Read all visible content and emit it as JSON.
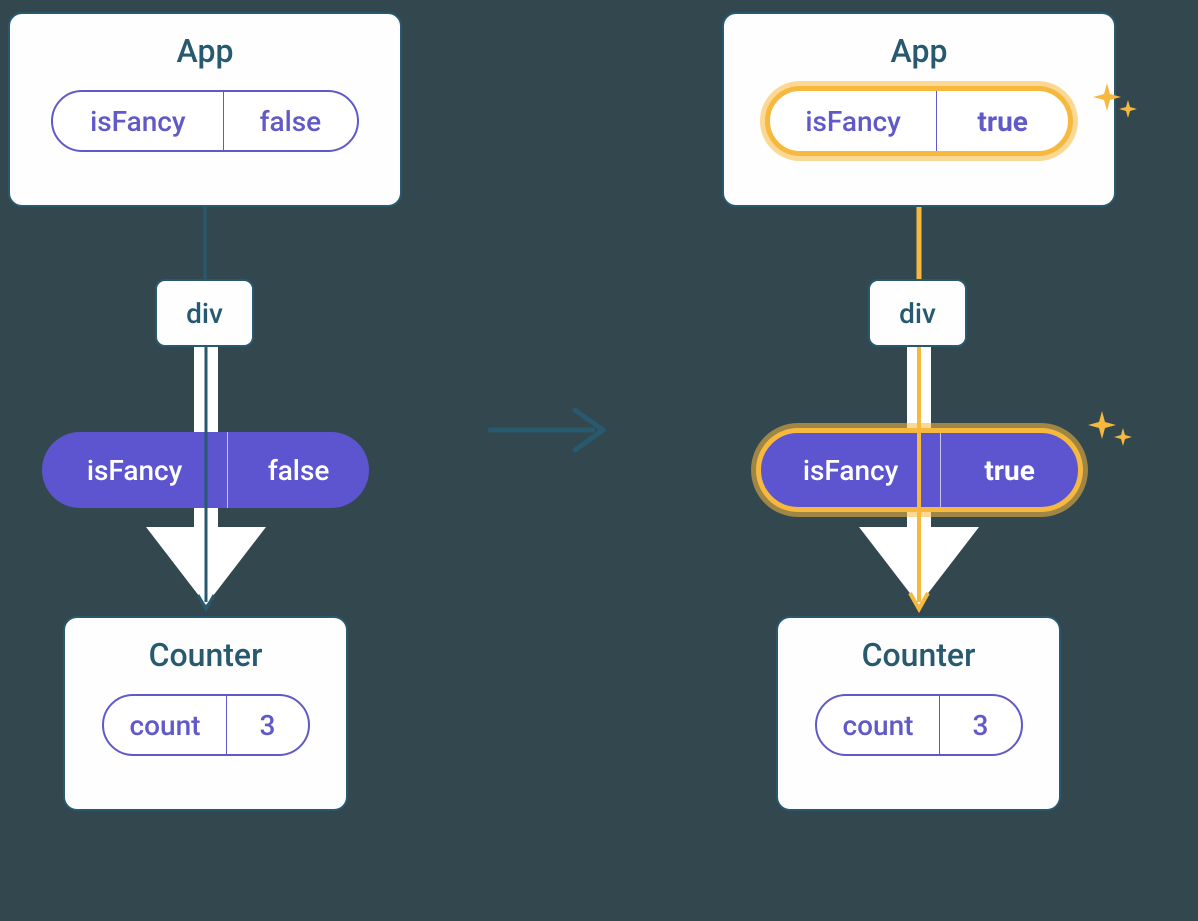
{
  "left": {
    "app": {
      "title": "App",
      "state": {
        "key": "isFancy",
        "value": "false"
      }
    },
    "div": {
      "label": "div"
    },
    "prop": {
      "key": "isFancy",
      "value": "false"
    },
    "counter": {
      "title": "Counter",
      "state": {
        "key": "count",
        "value": "3"
      }
    }
  },
  "right": {
    "app": {
      "title": "App",
      "state": {
        "key": "isFancy",
        "value": "true"
      }
    },
    "div": {
      "label": "div"
    },
    "prop": {
      "key": "isFancy",
      "value": "true"
    },
    "counter": {
      "title": "Counter",
      "state": {
        "key": "count",
        "value": "3"
      }
    }
  },
  "colors": {
    "bg": "#33474f",
    "teal": "#27596f",
    "purple": "#5d55d0",
    "purpleText": "#6059c8",
    "gold": "#f7b93d"
  }
}
